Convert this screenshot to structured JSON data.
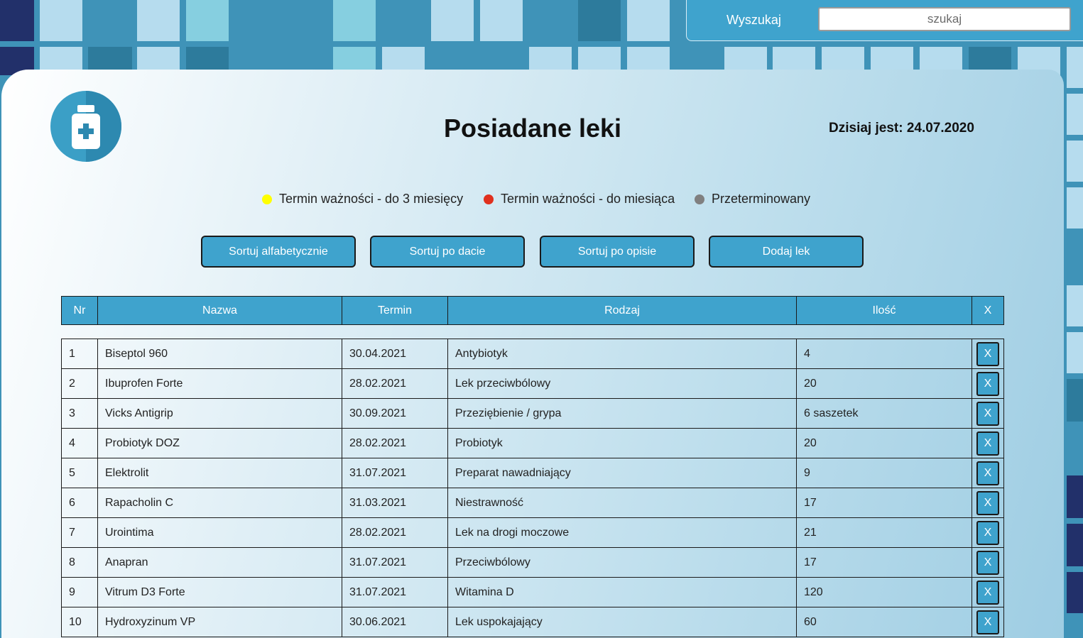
{
  "search": {
    "label": "Wyszukaj",
    "placeholder": "szukaj",
    "value": ""
  },
  "header": {
    "title": "Posiadane leki",
    "today": "Dzisiaj jest: 24.07.2020"
  },
  "legend": [
    {
      "label": "Termin ważności - do 3 miesięcy",
      "color": "#ffff00"
    },
    {
      "label": "Termin ważności - do miesiąca",
      "color": "#e0301e"
    },
    {
      "label": "Przeterminowany",
      "color": "#808080"
    }
  ],
  "buttons": {
    "sort_alpha": "Sortuj alfabetycznie",
    "sort_date": "Sortuj po dacie",
    "sort_desc": "Sortuj po opisie",
    "add": "Dodaj lek"
  },
  "table": {
    "headers": {
      "nr": "Nr",
      "name": "Nazwa",
      "term": "Termin",
      "type": "Rodzaj",
      "qty": "Ilość",
      "delete": "X"
    },
    "delete_label": "X",
    "rows": [
      {
        "nr": "1",
        "name": "Biseptol 960",
        "term": "30.04.2021",
        "type": "Antybiotyk",
        "qty": "4"
      },
      {
        "nr": "2",
        "name": "Ibuprofen Forte",
        "term": "28.02.2021",
        "type": "Lek przeciwbólowy",
        "qty": "20"
      },
      {
        "nr": "3",
        "name": "Vicks Antigrip",
        "term": "30.09.2021",
        "type": "Przeziębienie / grypa",
        "qty": "6 saszetek"
      },
      {
        "nr": "4",
        "name": "Probiotyk DOZ",
        "term": "28.02.2021",
        "type": "Probiotyk",
        "qty": "20"
      },
      {
        "nr": "5",
        "name": "Elektrolit",
        "term": "31.07.2021",
        "type": "Preparat nawadniający",
        "qty": "9"
      },
      {
        "nr": "6",
        "name": "Rapacholin C",
        "term": "31.03.2021",
        "type": "Niestrawność",
        "qty": "17"
      },
      {
        "nr": "7",
        "name": "Urointima",
        "term": "28.02.2021",
        "type": "Lek na drogi moczowe",
        "qty": "21"
      },
      {
        "nr": "8",
        "name": "Anapran",
        "term": "31.07.2021",
        "type": "Przeciwbólowy",
        "qty": "17"
      },
      {
        "nr": "9",
        "name": "Vitrum D3 Forte",
        "term": "31.07.2021",
        "type": "Witamina D",
        "qty": "120"
      },
      {
        "nr": "10",
        "name": "Hydroxyzinum VP",
        "term": "30.06.2021",
        "type": "Lek uspokajający",
        "qty": "60"
      }
    ]
  }
}
